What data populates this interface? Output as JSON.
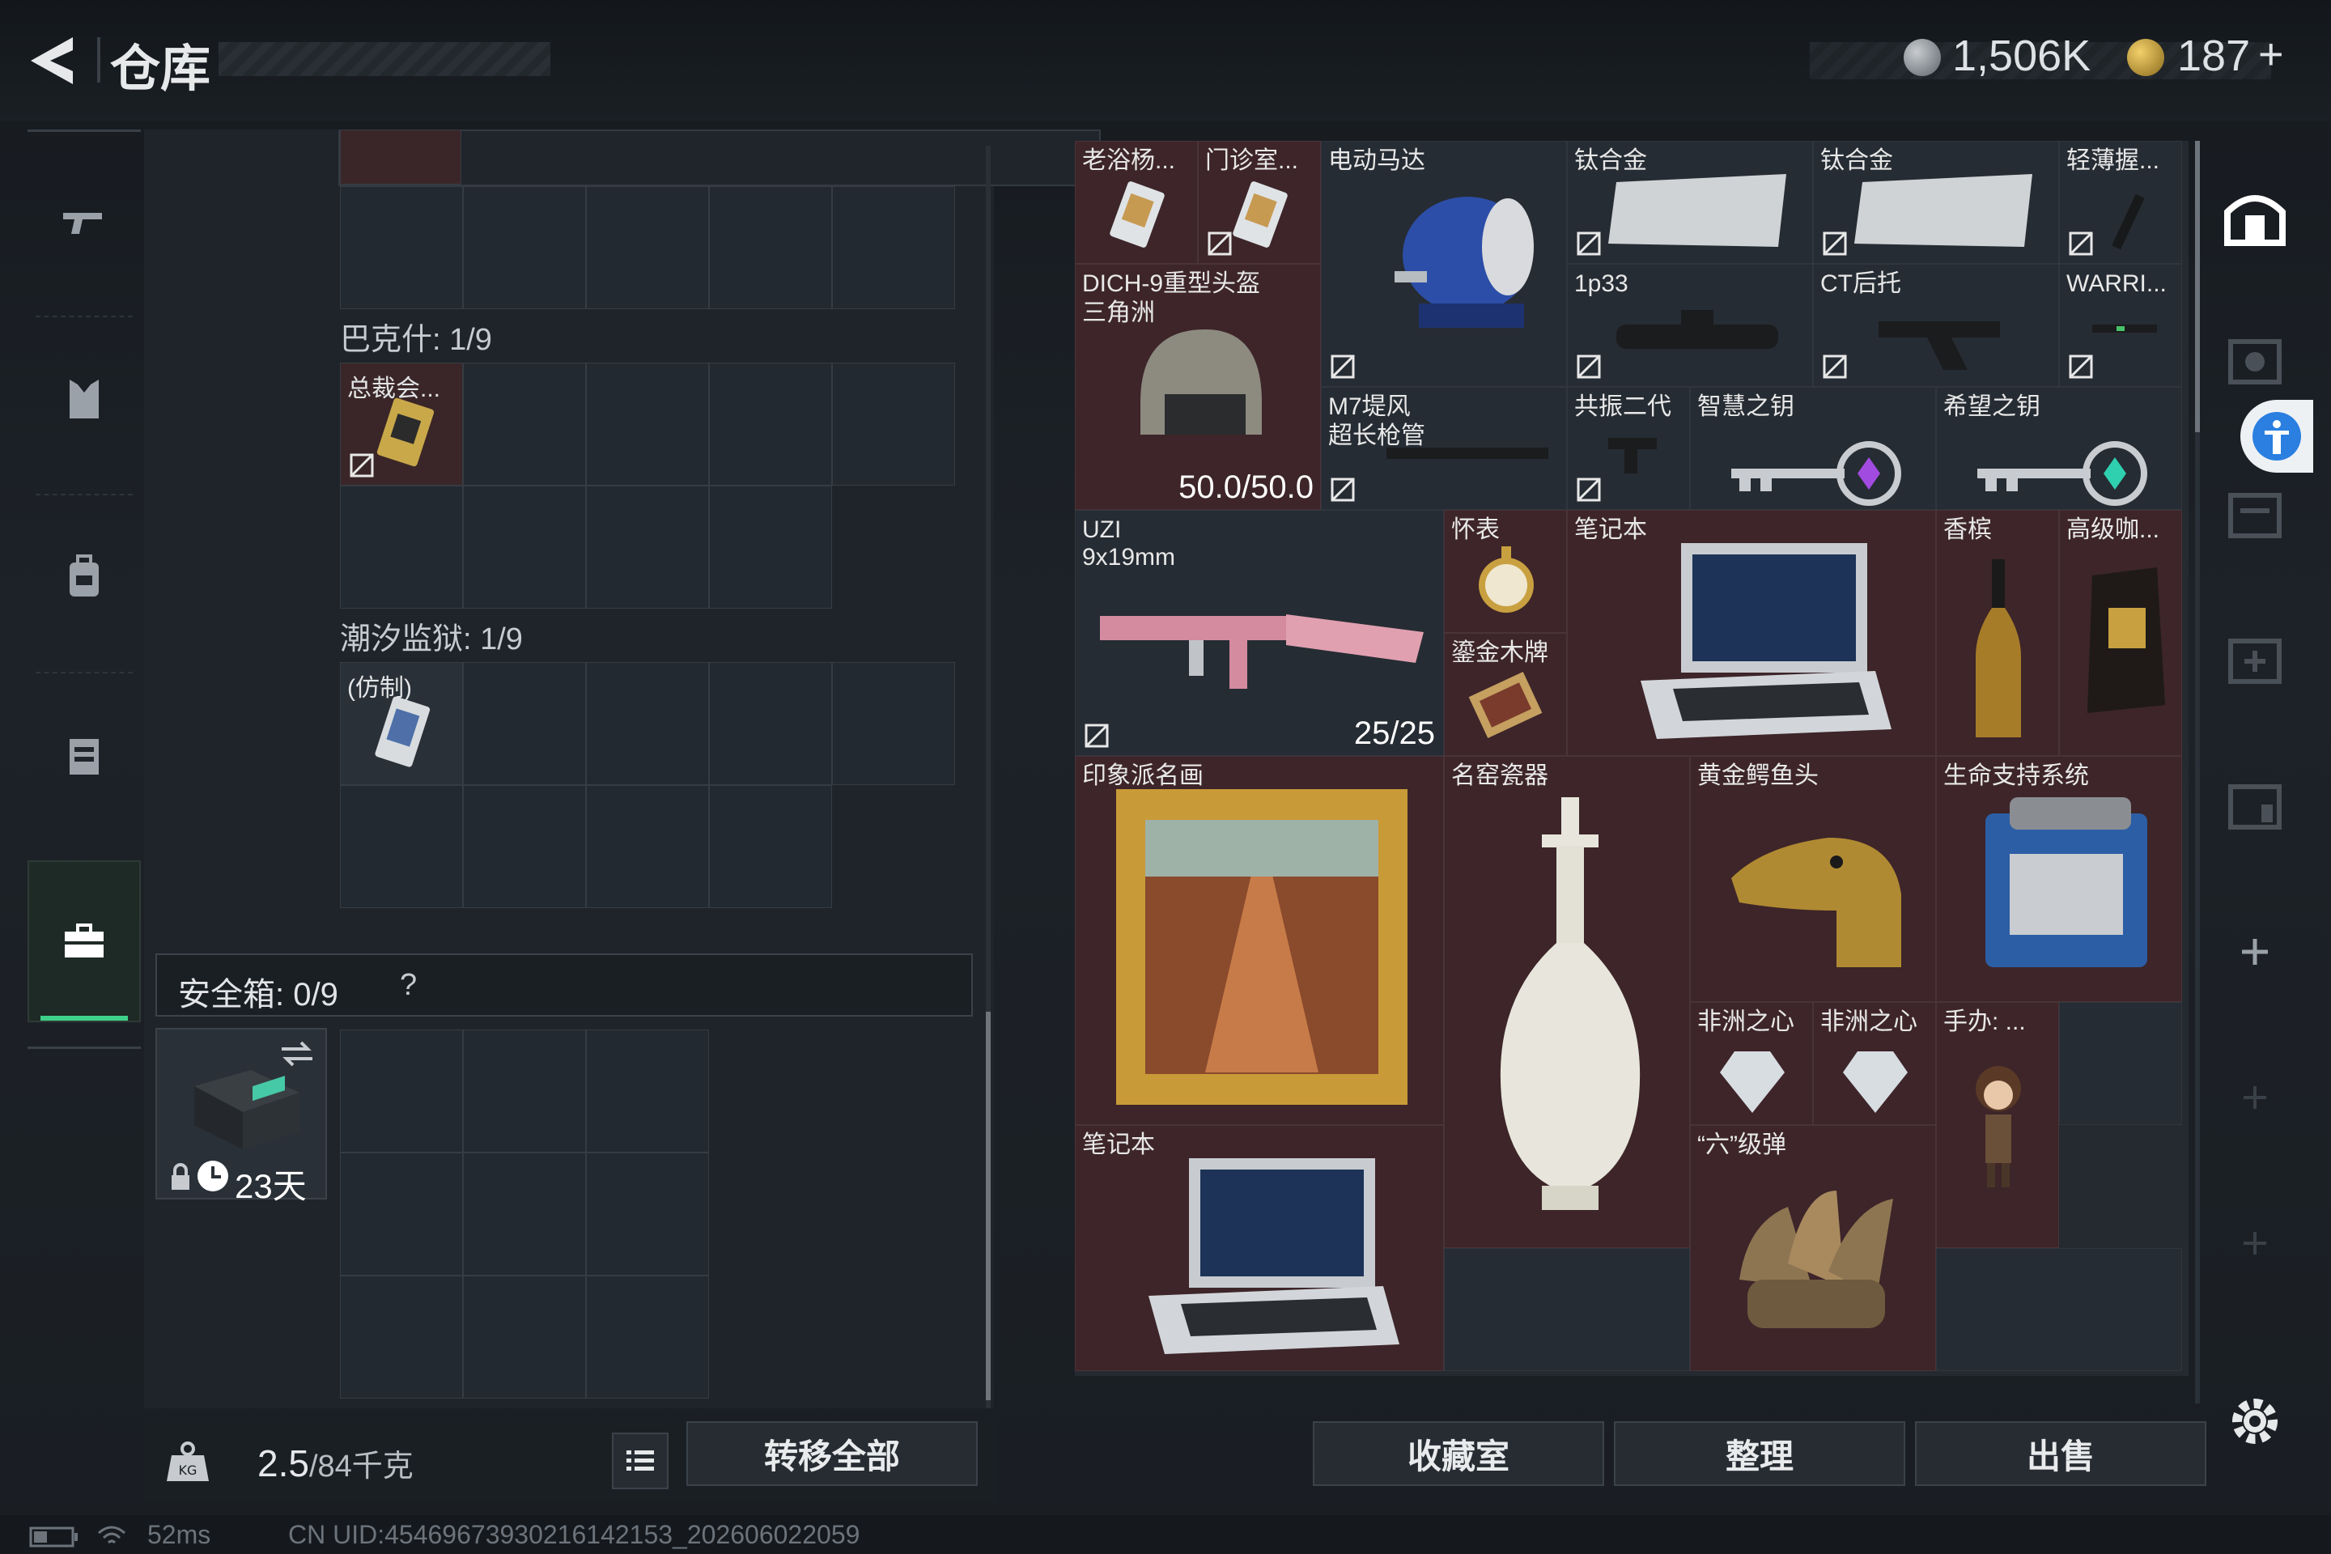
{
  "header": {
    "title": "仓库",
    "currency1": "1,506K",
    "currency2": "187",
    "currency2_plus": "+"
  },
  "left_nav": {
    "items": [
      "weapons",
      "armor",
      "backpack",
      "rig",
      "case"
    ]
  },
  "containers": [
    {
      "label": "巴克什: 1/9",
      "item": "总裁会..."
    },
    {
      "label": "潮汐监狱: 1/9",
      "item": "(仿制)"
    }
  ],
  "top_item": "",
  "safe_box": {
    "label": "安全箱: 0/9",
    "help": "?",
    "days": "23天"
  },
  "weight": {
    "value": "2.5",
    "max": "/84千克"
  },
  "buttons": {
    "transfer_all": "转移全部",
    "collection": "收藏室",
    "organize": "整理",
    "sell": "出售"
  },
  "status_bar": {
    "ping": "52ms",
    "uid": "CN UID:4546967393021614​2153_202606022059"
  },
  "items": {
    "i1": "老浴杨...",
    "i2": "门诊室...",
    "i3": "电动马达",
    "i4": "钛合金",
    "i5": "钛合金",
    "i6": "轻薄握...",
    "i7": "DICH-9重型头盔",
    "i7b": "三角洲",
    "i7c": "50.0/50.0",
    "i8": "1p33",
    "i9": "CT后托",
    "i10": "WARRI...",
    "i11": "M7堤风",
    "i11b": "超长枪管",
    "i12": "共振二代",
    "i13": "智慧之钥",
    "i14": "希望之钥",
    "i15": "UZI",
    "i15b": "9x19mm",
    "i15c": "25/25",
    "i16": "怀表",
    "i17": "笔记本",
    "i18": "香槟",
    "i19": "高级咖...",
    "i20": "鎏金木牌",
    "i21": "印象派名画",
    "i22": "名窑瓷器",
    "i23": "黄金鳄鱼头",
    "i24": "生命支持系统",
    "i25": "非洲之心",
    "i26": "非洲之心",
    "i27": "手办: ...",
    "i28": "笔记本",
    "i29": "“六”级弹"
  },
  "colors": {
    "item_red": "#3d2529",
    "bg": "#1c2127",
    "accent_blue": "#2a7fe0"
  }
}
